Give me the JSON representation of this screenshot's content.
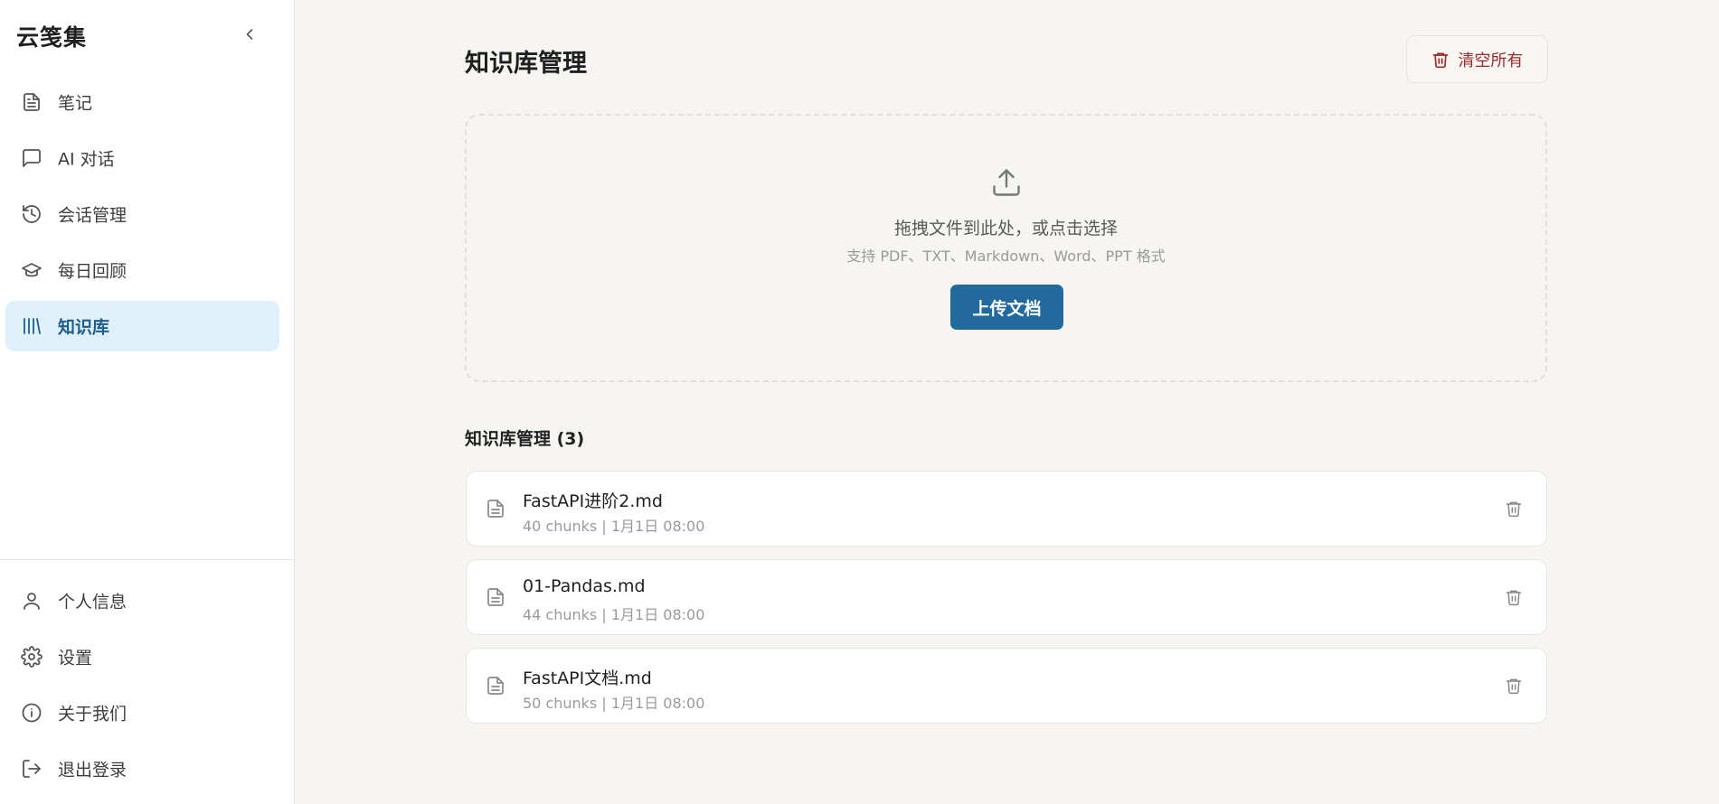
{
  "sidebar": {
    "brand": "云笺集",
    "items": [
      {
        "label": "笔记",
        "icon": "file-text-icon"
      },
      {
        "label": "AI 对话",
        "icon": "message-square-icon"
      },
      {
        "label": "会话管理",
        "icon": "history-icon"
      },
      {
        "label": "每日回顾",
        "icon": "graduation-cap-icon"
      },
      {
        "label": "知识库",
        "icon": "library-icon",
        "active": true
      }
    ],
    "bottom_items": [
      {
        "label": "个人信息",
        "icon": "user-icon"
      },
      {
        "label": "设置",
        "icon": "gear-icon"
      },
      {
        "label": "关于我们",
        "icon": "info-icon"
      },
      {
        "label": "退出登录",
        "icon": "logout-icon"
      }
    ]
  },
  "main": {
    "title": "知识库管理",
    "clear_all_label": "清空所有",
    "dropzone": {
      "title": "拖拽文件到此处，或点击选择",
      "hint": "支持 PDF、TXT、Markdown、Word、PPT 格式",
      "upload_label": "上传文档"
    },
    "list_title": "知识库管理 (3)",
    "documents": [
      {
        "name": "FastAPI进阶2.md",
        "meta": "40 chunks | 1月1日 08:00"
      },
      {
        "name": "01-Pandas.md",
        "meta": "44 chunks | 1月1日 08:00"
      },
      {
        "name": "FastAPI文档.md",
        "meta": "50 chunks | 1月1日 08:00"
      }
    ]
  },
  "colors": {
    "accent": "#226a9e",
    "active_nav_bg": "#e0f0fb",
    "danger": "#9b2b2b",
    "page_bg": "#f6f5f2"
  }
}
